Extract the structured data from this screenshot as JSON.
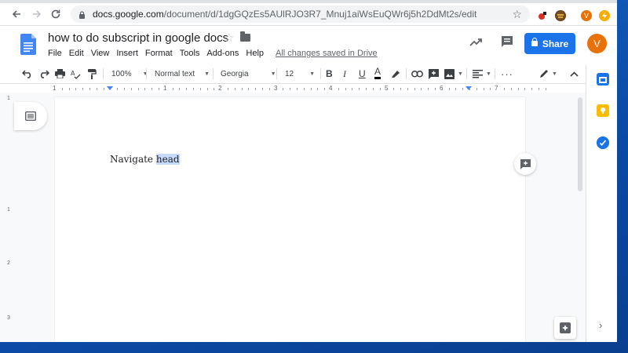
{
  "browser": {
    "url_host": "docs.google.com",
    "url_path": "/document/d/1dgGQzEs5AUlRJO3R7_Mnuj1aiWsEuQWr6j5h2DdMt2s/edit",
    "profile_initial": "V",
    "icons": [
      "back-icon",
      "forward-icon",
      "reload-icon",
      "lock-icon",
      "bookmark-star-icon"
    ]
  },
  "docs": {
    "title": "how to do subscript in google docs",
    "menu": [
      "File",
      "Edit",
      "View",
      "Insert",
      "Format",
      "Tools",
      "Add-ons",
      "Help"
    ],
    "save_status": "All changes saved in Drive",
    "share_label": "Share",
    "user_initial": "V"
  },
  "toolbar": {
    "zoom": "100%",
    "style": "Normal text",
    "font": "Georgia",
    "font_size": "12",
    "bold": "B",
    "italic": "I",
    "underline": "U",
    "text_color": "A"
  },
  "ruler": {
    "labels": [
      "1",
      "1",
      "2",
      "3",
      "4",
      "5",
      "6",
      "7"
    ]
  },
  "vertical_ruler": {
    "labels": [
      "1",
      "1",
      "2",
      "3"
    ]
  },
  "document": {
    "text_before": "Navigate ",
    "text_selected": "head"
  },
  "colors": {
    "accent": "#1a73e8",
    "selection": "#c6dafc",
    "avatar": "#e8710a"
  }
}
